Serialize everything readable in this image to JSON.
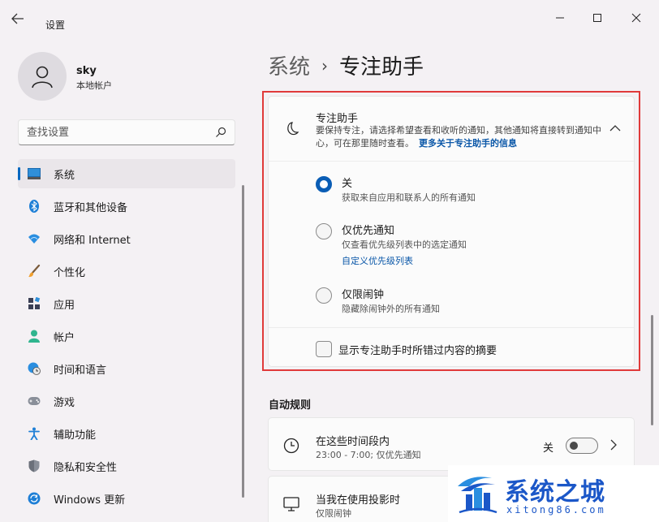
{
  "window": {
    "title": "设置"
  },
  "profile": {
    "name": "sky",
    "account_type": "本地帐户"
  },
  "search": {
    "placeholder": "查找设置"
  },
  "sidebar": {
    "items": [
      {
        "label": "系统",
        "icon": "system-icon",
        "active": true
      },
      {
        "label": "蓝牙和其他设备",
        "icon": "bluetooth-icon"
      },
      {
        "label": "网络和 Internet",
        "icon": "wifi-icon"
      },
      {
        "label": "个性化",
        "icon": "brush-icon"
      },
      {
        "label": "应用",
        "icon": "apps-icon"
      },
      {
        "label": "帐户",
        "icon": "account-icon"
      },
      {
        "label": "时间和语言",
        "icon": "globe-clock-icon"
      },
      {
        "label": "游戏",
        "icon": "gamepad-icon"
      },
      {
        "label": "辅助功能",
        "icon": "accessibility-icon"
      },
      {
        "label": "隐私和安全性",
        "icon": "shield-icon"
      },
      {
        "label": "Windows 更新",
        "icon": "update-icon"
      }
    ]
  },
  "breadcrumb": {
    "parent": "系统",
    "separator": "›",
    "current": "专注助手"
  },
  "focus_assist": {
    "title": "专注助手",
    "description": "要保持专注，请选择希望查看和收听的通知，其他通知将直接转到通知中心，可在那里随时查看。",
    "more_link": "更多关于专注助手的信息",
    "options": [
      {
        "label": "关",
        "sub": "获取来自应用和联系人的所有通知",
        "checked": true
      },
      {
        "label": "仅优先通知",
        "sub": "仅查看优先级列表中的选定通知",
        "link": "自定义优先级列表",
        "checked": false
      },
      {
        "label": "仅限闹钟",
        "sub": "隐藏除闹钟外的所有通知",
        "checked": false
      }
    ],
    "summary_checkbox": "显示专注助手时所错过内容的摘要"
  },
  "auto_rules": {
    "title": "自动规则",
    "rules": [
      {
        "title": "在这些时间段内",
        "sub": "23:00 - 7:00; 仅优先通知",
        "toggle_label": "关",
        "toggle_on": false
      },
      {
        "title": "当我在使用投影时",
        "sub": "仅限闹钟"
      }
    ]
  },
  "watermark": {
    "title": "系统之城",
    "url": "xitong86.com"
  },
  "colors": {
    "accent": "#0067c0",
    "highlight_frame": "#e03a3a",
    "watermark": "#1b57c8"
  }
}
